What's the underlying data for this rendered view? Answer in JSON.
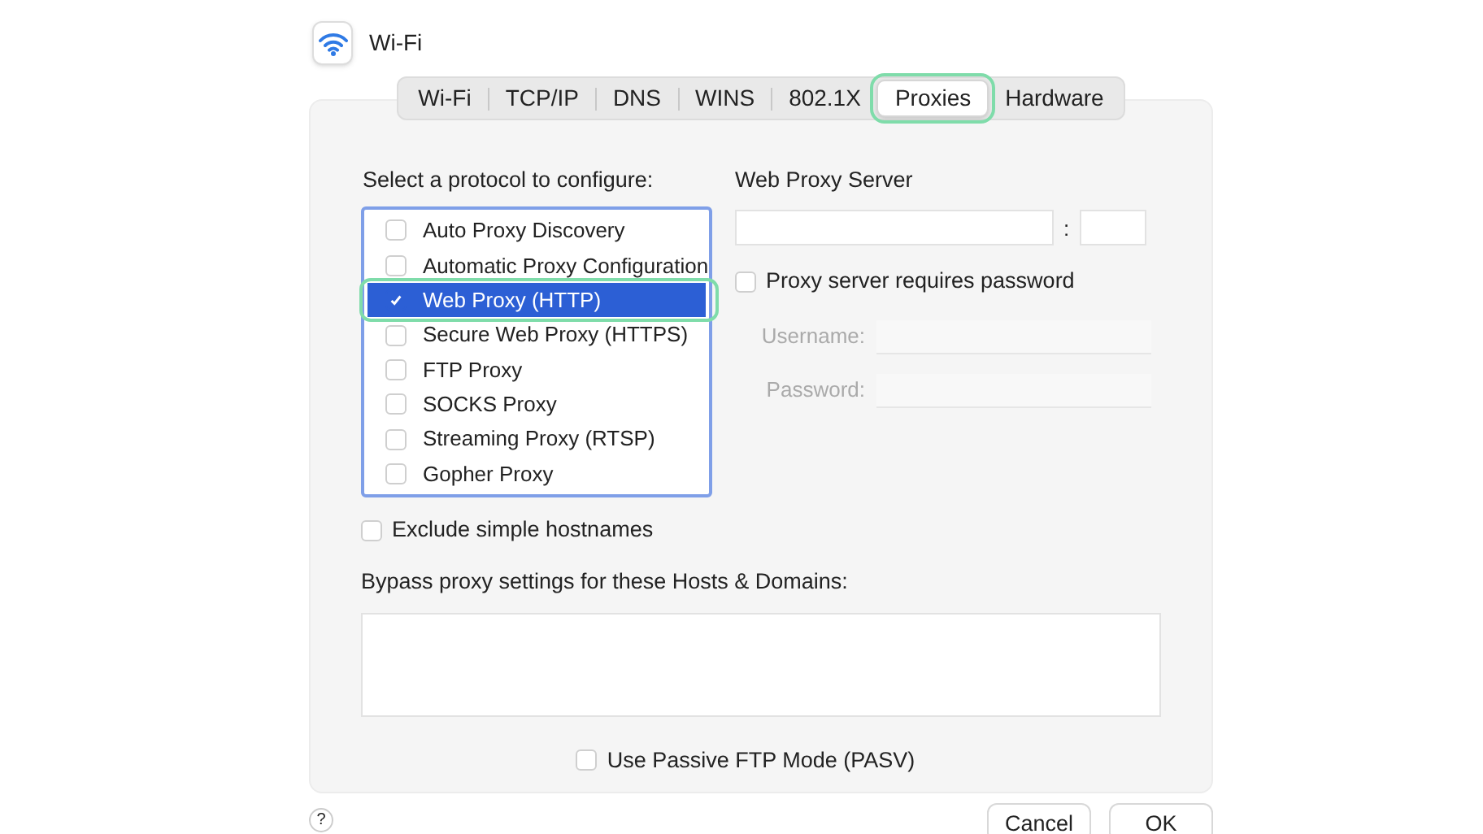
{
  "window": {
    "title": "Wi-Fi"
  },
  "tabs": [
    {
      "label": "Wi-Fi",
      "selected": false,
      "highlighted": false
    },
    {
      "label": "TCP/IP",
      "selected": false,
      "highlighted": false
    },
    {
      "label": "DNS",
      "selected": false,
      "highlighted": false
    },
    {
      "label": "WINS",
      "selected": false,
      "highlighted": false
    },
    {
      "label": "802.1X",
      "selected": false,
      "highlighted": false
    },
    {
      "label": "Proxies",
      "selected": true,
      "highlighted": true
    },
    {
      "label": "Hardware",
      "selected": false,
      "highlighted": false
    }
  ],
  "protocols": {
    "label": "Select a protocol to configure:",
    "items": [
      {
        "label": "Auto Proxy Discovery",
        "checked": false,
        "selected": false,
        "highlighted": false
      },
      {
        "label": "Automatic Proxy Configuration",
        "checked": false,
        "selected": false,
        "highlighted": false
      },
      {
        "label": "Web Proxy (HTTP)",
        "checked": true,
        "selected": true,
        "highlighted": true
      },
      {
        "label": "Secure Web Proxy (HTTPS)",
        "checked": false,
        "selected": false,
        "highlighted": false
      },
      {
        "label": "FTP Proxy",
        "checked": false,
        "selected": false,
        "highlighted": false
      },
      {
        "label": "SOCKS Proxy",
        "checked": false,
        "selected": false,
        "highlighted": false
      },
      {
        "label": "Streaming Proxy (RTSP)",
        "checked": false,
        "selected": false,
        "highlighted": false
      },
      {
        "label": "Gopher Proxy",
        "checked": false,
        "selected": false,
        "highlighted": false
      }
    ]
  },
  "server": {
    "label": "Web Proxy Server",
    "separator": ":",
    "requires_password": {
      "label": "Proxy server requires password",
      "checked": false
    },
    "username": {
      "label": "Username:",
      "disabled": true
    },
    "password": {
      "label": "Password:",
      "disabled": true
    }
  },
  "exclude_simple": {
    "label": "Exclude simple hostnames",
    "checked": false
  },
  "bypass": {
    "label": "Bypass proxy settings for these Hosts & Domains:"
  },
  "passive_ftp": {
    "label": "Use Passive FTP Mode (PASV)",
    "checked": false
  },
  "help": "?",
  "buttons": [
    "Cancel",
    "OK"
  ]
}
